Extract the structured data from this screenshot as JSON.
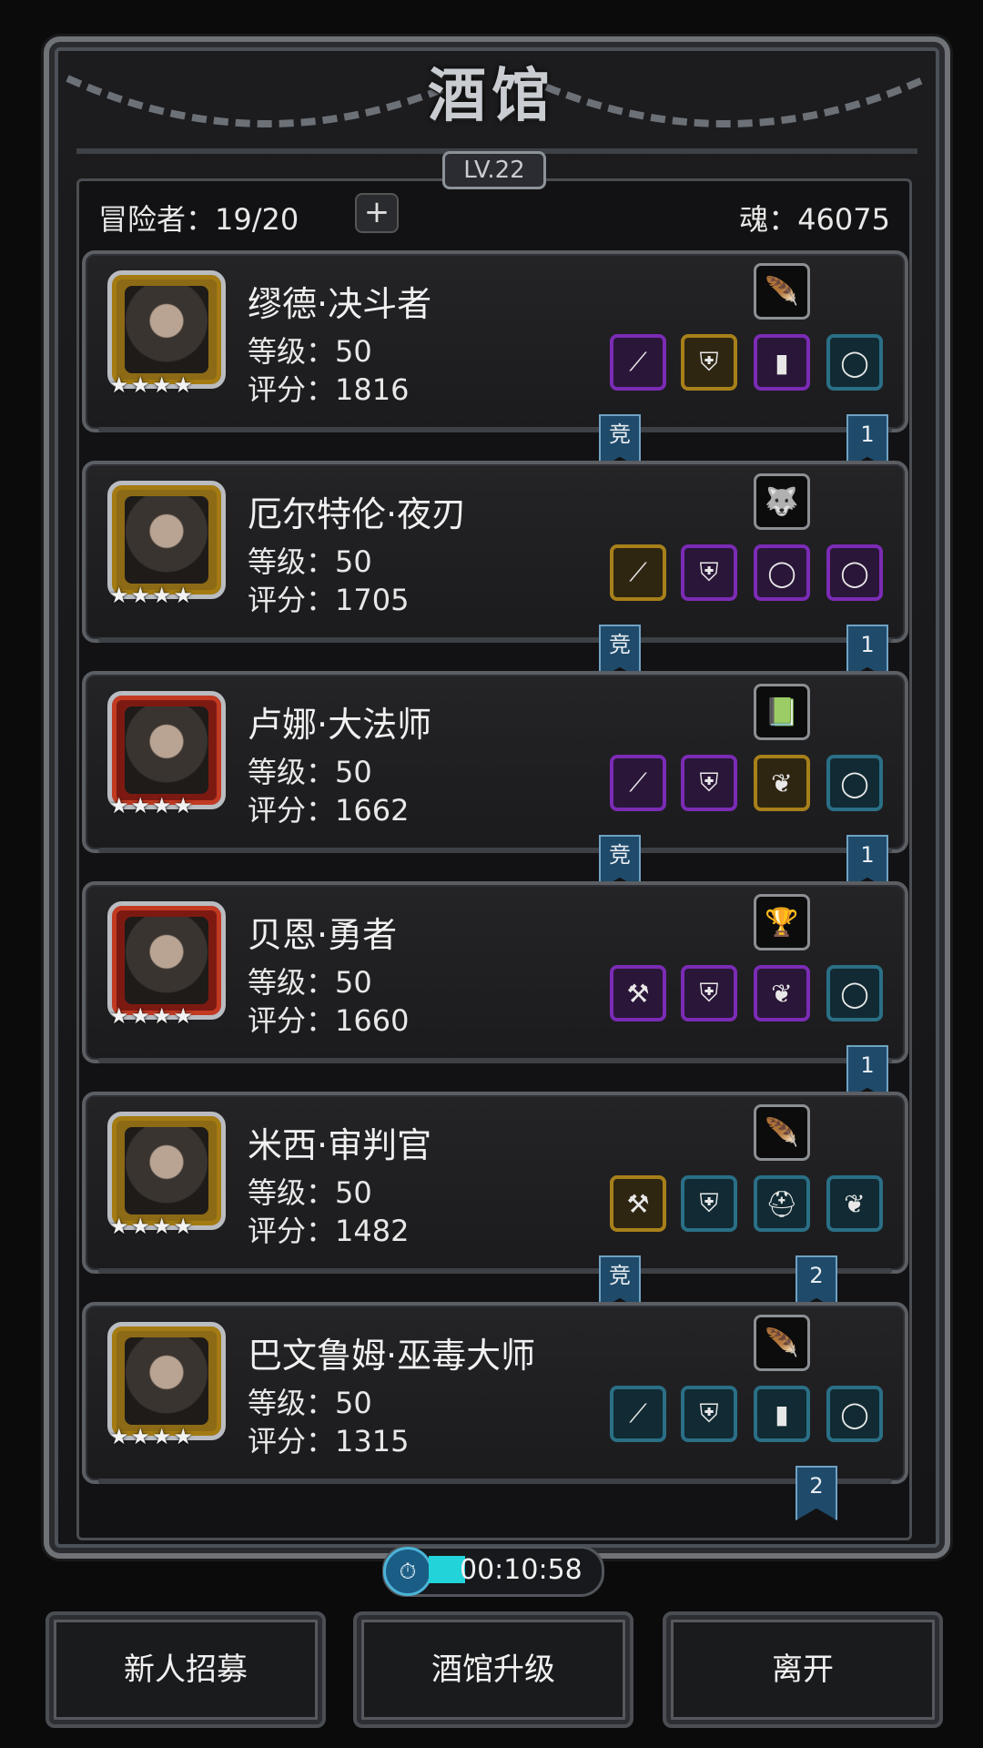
{
  "header": {
    "title": "酒馆",
    "level": "LV.22",
    "adventurers_label": "冒险者：19/20",
    "plus_label": "+",
    "soul_label": "魂：46075"
  },
  "heroes": [
    {
      "name": "缪德·决斗者",
      "level": "等级：50",
      "score": "评分：1816",
      "stars": "★★★★",
      "skill_icon": "feather-icon",
      "skill_glyph": "🪶",
      "frame": "gold",
      "equipment": [
        {
          "icon": "spear-icon",
          "glyph": "⟋",
          "rarity": "purple"
        },
        {
          "icon": "armor-icon",
          "glyph": "⛨",
          "rarity": "gold"
        },
        {
          "icon": "wood-shield-icon",
          "glyph": "▮",
          "rarity": "purple"
        },
        {
          "icon": "ring-icon",
          "glyph": "◯",
          "rarity": "teal"
        }
      ],
      "ribbon_left": "竞",
      "ribbon_right": "1"
    },
    {
      "name": "厄尔特伦·夜刃",
      "level": "等级：50",
      "score": "评分：1705",
      "stars": "★★★★",
      "skill_icon": "wolf-icon",
      "skill_glyph": "🐺",
      "frame": "gold",
      "equipment": [
        {
          "icon": "spear-icon",
          "glyph": "⟋",
          "rarity": "gold"
        },
        {
          "icon": "armor-icon",
          "glyph": "⛨",
          "rarity": "purple"
        },
        {
          "icon": "ring-icon",
          "glyph": "◯",
          "rarity": "purple"
        },
        {
          "icon": "ring-icon",
          "glyph": "◯",
          "rarity": "purple"
        }
      ],
      "ribbon_left": "竞",
      "ribbon_right": "1"
    },
    {
      "name": "卢娜·大法师",
      "level": "等级：50",
      "score": "评分：1662",
      "stars": "★★★★",
      "skill_icon": "green-scroll-icon",
      "skill_glyph": "📗",
      "frame": "red",
      "equipment": [
        {
          "icon": "staff-icon",
          "glyph": "⟋",
          "rarity": "purple"
        },
        {
          "icon": "armor-icon",
          "glyph": "⛨",
          "rarity": "purple"
        },
        {
          "icon": "necklace-icon",
          "glyph": "❦",
          "rarity": "gold"
        },
        {
          "icon": "ring-icon",
          "glyph": "◯",
          "rarity": "teal"
        }
      ],
      "ribbon_left": "竞",
      "ribbon_right": "1"
    },
    {
      "name": "贝恩·勇者",
      "level": "等级：50",
      "score": "评分：1660",
      "stars": "★★★★",
      "skill_icon": "trophy-icon",
      "skill_glyph": "🏆",
      "frame": "red",
      "equipment": [
        {
          "icon": "axe-icon",
          "glyph": "⚒",
          "rarity": "purple"
        },
        {
          "icon": "armor-icon",
          "glyph": "⛨",
          "rarity": "purple"
        },
        {
          "icon": "necklace-icon",
          "glyph": "❦",
          "rarity": "purple"
        },
        {
          "icon": "ring-icon",
          "glyph": "◯",
          "rarity": "teal"
        }
      ],
      "ribbon_left": "",
      "ribbon_right": "1"
    },
    {
      "name": "米西·审判官",
      "level": "等级：50",
      "score": "评分：1482",
      "stars": "★★★★",
      "skill_icon": "feather-icon",
      "skill_glyph": "🪶",
      "frame": "gold",
      "equipment": [
        {
          "icon": "hammer-icon",
          "glyph": "⚒",
          "rarity": "gold"
        },
        {
          "icon": "armor-icon",
          "glyph": "⛨",
          "rarity": "teal"
        },
        {
          "icon": "helmet-icon",
          "glyph": "⛑",
          "rarity": "teal"
        },
        {
          "icon": "necklace-icon",
          "glyph": "❦",
          "rarity": "teal"
        }
      ],
      "ribbon_left": "竞",
      "ribbon_right": "2"
    },
    {
      "name": "巴文鲁姆·巫毒大师",
      "level": "等级：50",
      "score": "评分：1315",
      "stars": "★★★★",
      "skill_icon": "feather-icon",
      "skill_glyph": "🪶",
      "frame": "gold",
      "equipment": [
        {
          "icon": "staff-icon",
          "glyph": "⟋",
          "rarity": "teal"
        },
        {
          "icon": "armor-icon",
          "glyph": "⛨",
          "rarity": "teal"
        },
        {
          "icon": "wood-shield-icon",
          "glyph": "▮",
          "rarity": "teal"
        },
        {
          "icon": "ring-icon",
          "glyph": "◯",
          "rarity": "teal"
        }
      ],
      "ribbon_left": "",
      "ribbon_right": "2"
    }
  ],
  "timer": {
    "value": "00:10:58"
  },
  "buttons": {
    "recruit": "新人招募",
    "upgrade": "酒馆升级",
    "leave": "离开"
  }
}
